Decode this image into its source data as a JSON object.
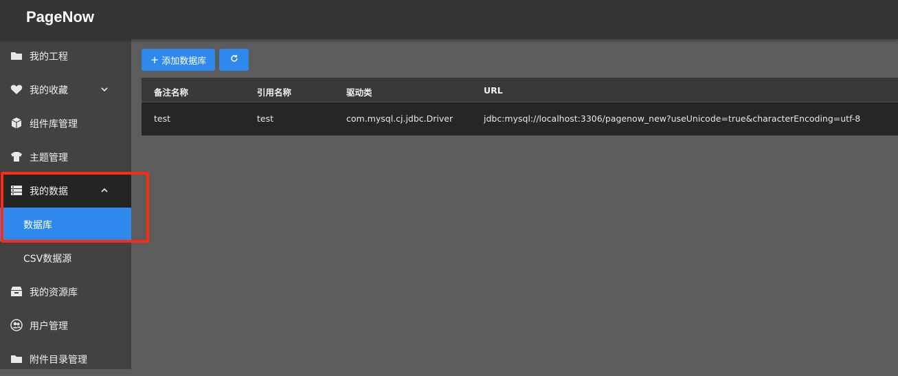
{
  "app": {
    "brand": "PageNow"
  },
  "sidebar": {
    "items": [
      {
        "label": "我的工程",
        "icon": "folder-icon"
      },
      {
        "label": "我的收藏",
        "icon": "heart-icon",
        "chevron": "chevron-down-icon"
      },
      {
        "label": "组件库管理",
        "icon": "cube-icon"
      },
      {
        "label": "主题管理",
        "icon": "shirt-icon"
      },
      {
        "label": "我的数据",
        "icon": "server-icon",
        "chevron": "chevron-up-icon",
        "expanded": true
      },
      {
        "label": "我的资源库",
        "icon": "archive-icon"
      },
      {
        "label": "用户管理",
        "icon": "users-icon"
      },
      {
        "label": "附件目录管理",
        "icon": "folder-icon"
      }
    ],
    "data_children": [
      {
        "label": "数据库",
        "active": true
      },
      {
        "label": "CSV数据源",
        "active": false
      }
    ]
  },
  "toolbar": {
    "add_label": "添加数据库",
    "add_icon": "plus-icon",
    "refresh_icon": "refresh-icon"
  },
  "table": {
    "columns": [
      "备注名称",
      "引用名称",
      "驱动类",
      "URL"
    ],
    "rows": [
      [
        "test",
        "test",
        "com.mysql.cj.jdbc.Driver",
        "jdbc:mysql://localhost:3306/pagenow_new?useUnicode=true&characterEncoding=utf-8"
      ]
    ]
  },
  "colors": {
    "accent": "#2f88ec",
    "highlight": "#ff2a12",
    "header_bg": "#353535",
    "sidebar_bg": "#424242",
    "content_bg": "#5c5c5c"
  }
}
